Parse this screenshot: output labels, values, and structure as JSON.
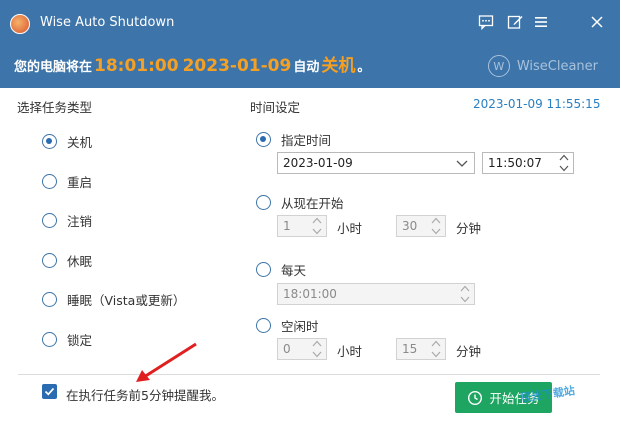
{
  "window": {
    "title": "Wise Auto Shutdown",
    "icons": [
      "feedback-icon",
      "edit-icon",
      "menu-icon",
      "close-icon"
    ]
  },
  "banner": {
    "prefix": "您的电脑将在",
    "time": "18:01:00",
    "date": "2023-01-09",
    "mid": "自动",
    "action": "关机",
    "suffix": "。",
    "brand": "WiseCleaner",
    "brand_logo": "W"
  },
  "task_type": {
    "heading": "选择任务类型",
    "options": [
      {
        "label": "关机",
        "checked": true
      },
      {
        "label": "重启",
        "checked": false
      },
      {
        "label": "注销",
        "checked": false
      },
      {
        "label": "休眠",
        "checked": false
      },
      {
        "label": "睡眠（Vista或更新）",
        "checked": false
      },
      {
        "label": "锁定",
        "checked": false
      }
    ]
  },
  "time_setting": {
    "heading": "时间设定",
    "current_time": "2023-01-09 11:55:15",
    "specified": {
      "label": "指定时间",
      "checked": true,
      "date": "2023-01-09",
      "time": "11:50:07"
    },
    "from_now": {
      "label": "从现在开始",
      "checked": false,
      "hours": "1",
      "hours_unit": "小时",
      "minutes": "30",
      "minutes_unit": "分钟"
    },
    "daily": {
      "label": "每天",
      "checked": false,
      "time": "18:01:00"
    },
    "idle": {
      "label": "空闲时",
      "checked": false,
      "hours": "0",
      "hours_unit": "小时",
      "minutes": "15",
      "minutes_unit": "分钟"
    }
  },
  "footer": {
    "remind_label": "在执行任务前5分钟提醒我。",
    "remind_checked": true,
    "start_button": "开始任务",
    "watermark": "极光下载站"
  },
  "colors": {
    "title_bar": "#3d74a9",
    "accent_orange": "#f5a023",
    "start_green": "#1ea562",
    "timestamp_blue": "#2a7fc1"
  }
}
